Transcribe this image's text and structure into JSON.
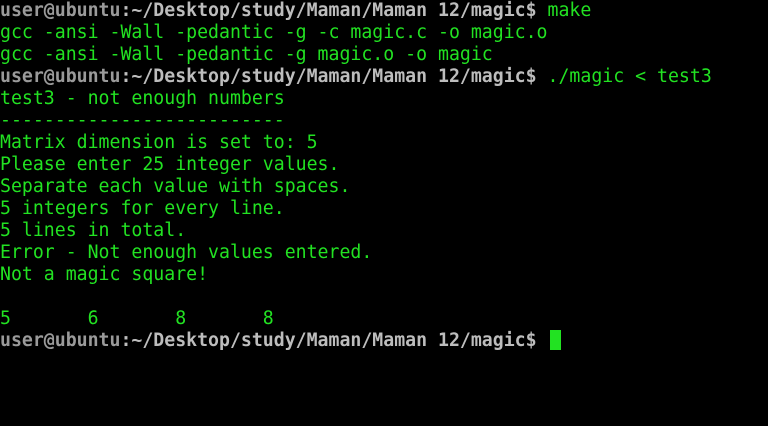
{
  "prompt": {
    "user_host": "user@ubuntu",
    "separator": ":",
    "path": "~/Desktop/study/Maman/Maman 12/magic$",
    "path_color": "#bdbdbd",
    "user_color": "#9a9a9a"
  },
  "text_color": "#22e222",
  "background_color": "#000000",
  "commands": [
    "make",
    "./magic < test3"
  ],
  "make_output": [
    "gcc -ansi -Wall -pedantic -g -c magic.c -o magic.o",
    "gcc -ansi -Wall -pedantic -g magic.o -o magic"
  ],
  "program_output": [
    "test3 - not enough numbers",
    "--------------------------",
    "Matrix dimension is set to: 5",
    "Please enter 25 integer values.",
    "Separate each value with spaces.",
    "5 integers for every line.",
    "5 lines in total.",
    "Error - Not enough values entered.",
    "Not a magic square!",
    "",
    "5       6       8       8"
  ],
  "cursor_icon": "block-cursor"
}
